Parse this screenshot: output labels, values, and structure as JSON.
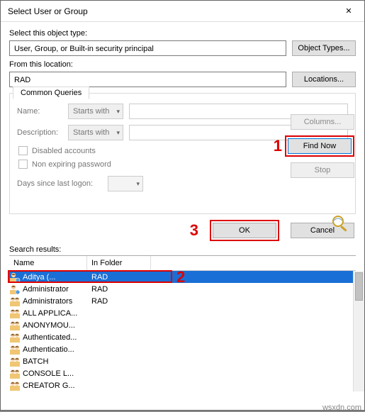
{
  "title": "Select User or Group",
  "object_type_label": "Select this object type:",
  "object_type_value": "User, Group, or Built-in security principal",
  "object_types_btn": "Object Types...",
  "location_label": "From this location:",
  "location_value": "RAD",
  "locations_btn": "Locations...",
  "tab": "Common Queries",
  "name_label": "Name:",
  "name_mode": "Starts with",
  "desc_label": "Description:",
  "desc_mode": "Starts with",
  "chk_disabled": "Disabled accounts",
  "chk_nonexp": "Non expiring password",
  "days_label": "Days since last logon:",
  "columns_btn": "Columns...",
  "findnow_btn": "Find Now",
  "stop_btn": "Stop",
  "ok_btn": "OK",
  "cancel_btn": "Cancel",
  "search_results_label": "Search results:",
  "col_name": "Name",
  "col_folder": "In Folder",
  "rows": [
    {
      "name": "Aditya",
      "extra": "(...",
      "folder": "RAD",
      "icon": "user",
      "selected": true
    },
    {
      "name": "Administrator",
      "folder": "RAD",
      "icon": "user"
    },
    {
      "name": "Administrators",
      "folder": "RAD",
      "icon": "group"
    },
    {
      "name": "ALL APPLICA...",
      "folder": "",
      "icon": "group"
    },
    {
      "name": "ANONYMOU...",
      "folder": "",
      "icon": "group"
    },
    {
      "name": "Authenticated...",
      "folder": "",
      "icon": "group"
    },
    {
      "name": "Authenticatio...",
      "folder": "",
      "icon": "group"
    },
    {
      "name": "BATCH",
      "folder": "",
      "icon": "group"
    },
    {
      "name": "CONSOLE L...",
      "folder": "",
      "icon": "group"
    },
    {
      "name": "CREATOR G...",
      "folder": "",
      "icon": "group"
    }
  ],
  "annotations": {
    "a1": "1",
    "a2": "2",
    "a3": "3"
  },
  "watermark": "wsxdn.com"
}
